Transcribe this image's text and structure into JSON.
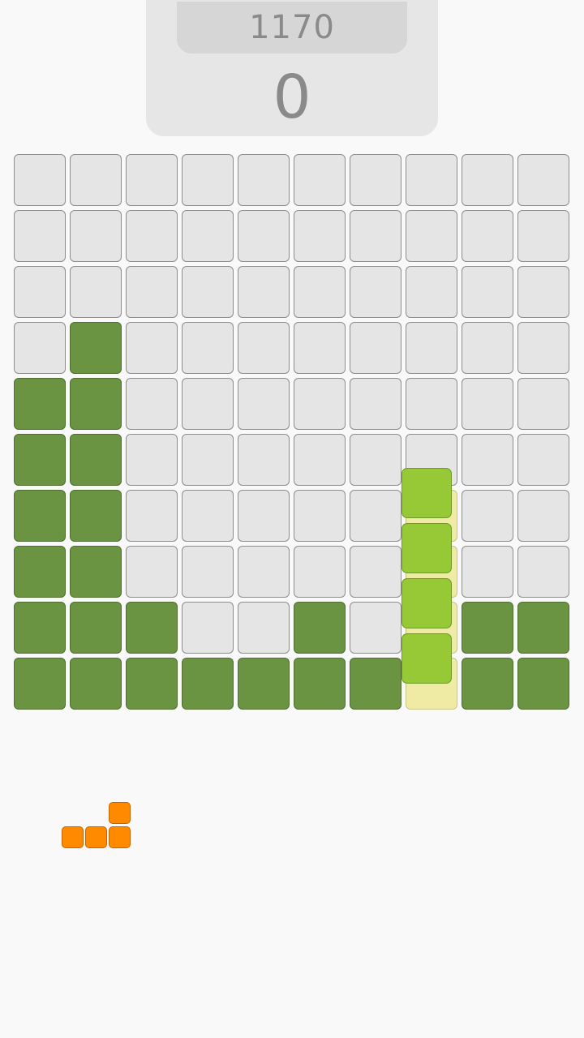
{
  "score_panel": {
    "best_score": "1170",
    "current_score": "0"
  },
  "board": {
    "columns": 10,
    "rows": 10,
    "filled_cells": [
      [
        3,
        1
      ],
      [
        4,
        0
      ],
      [
        4,
        1
      ],
      [
        5,
        0
      ],
      [
        5,
        1
      ],
      [
        6,
        0
      ],
      [
        6,
        1
      ],
      [
        7,
        0
      ],
      [
        7,
        1
      ],
      [
        8,
        0
      ],
      [
        8,
        1
      ],
      [
        8,
        2
      ],
      [
        8,
        5
      ],
      [
        8,
        8
      ],
      [
        8,
        9
      ],
      [
        9,
        0
      ],
      [
        9,
        1
      ],
      [
        9,
        2
      ],
      [
        9,
        3
      ],
      [
        9,
        4
      ],
      [
        9,
        5
      ],
      [
        9,
        6
      ],
      [
        9,
        8
      ],
      [
        9,
        9
      ]
    ],
    "ghost_cells": [
      [
        6,
        7
      ],
      [
        7,
        7
      ],
      [
        8,
        7
      ],
      [
        9,
        7
      ]
    ],
    "active_piece": {
      "shape": "I-vertical",
      "column": 7,
      "blocks": 4
    }
  },
  "next_piece": {
    "shape": "L",
    "blocks": 4
  },
  "colors": {
    "background": "#f9f9f9",
    "empty_cell": "#e5e5e5",
    "filled_cell": "#6b9442",
    "active_piece": "#96c935",
    "ghost": "#efeba4",
    "next_piece": "#ff8a00",
    "score_text": "#8a8a8a"
  }
}
